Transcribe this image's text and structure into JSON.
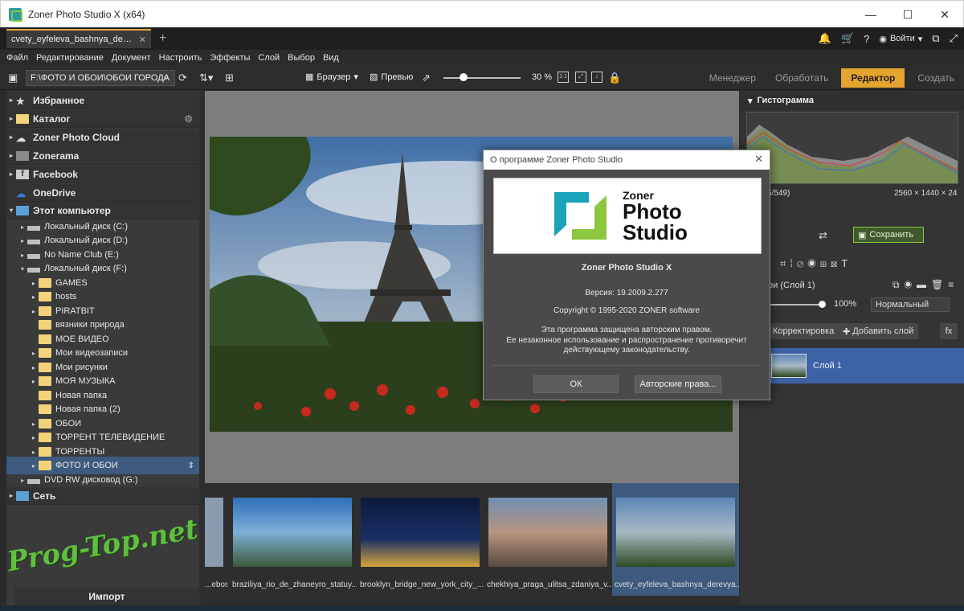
{
  "window": {
    "title": "Zoner Photo Studio X (x64)"
  },
  "tab": {
    "label": "cvety_eyfeleva_bashnya_dere..."
  },
  "header_right": {
    "login": "Войти"
  },
  "menu": [
    "Файл",
    "Редактирование",
    "Документ",
    "Настроить",
    "Эффекты",
    "Слой",
    "Выбор",
    "Вид"
  ],
  "toolbar": {
    "path": "F:\\ФОТО И ОБОИ\\ОБОИ ГОРОДА",
    "browser": "Браузер",
    "preview": "Превью",
    "zoom": "30 %",
    "fit_label": "1:1"
  },
  "modes": [
    "Менеджер",
    "Обработать",
    "Редактор",
    "Создать"
  ],
  "navigator": {
    "top_items": [
      {
        "label": "Избранное",
        "icon": "star-icon"
      },
      {
        "label": "Каталог",
        "icon": "catalog-icon"
      },
      {
        "label": "Zoner Photo Cloud",
        "icon": "cloud-icon"
      },
      {
        "label": "Zonerama",
        "icon": "zonerama-icon"
      },
      {
        "label": "Facebook",
        "icon": "facebook-icon"
      },
      {
        "label": "OneDrive",
        "icon": "onedrive-icon"
      },
      {
        "label": "Этот компьютер",
        "icon": "computer-icon"
      }
    ],
    "drives": [
      "Локальный диск (C:)",
      "Локальный диск (D:)",
      "No Name Club (E:)",
      "Локальный диск (F:)"
    ],
    "folders": [
      "GAMES",
      "hosts",
      "PIRATBIT",
      "вязники природа",
      "МОЕ ВИДЕО",
      "Мои видеозаписи",
      "Мои рисунки",
      "МОЯ МУЗЫКА",
      "Новая папка",
      "Новая папка (2)",
      "ОБОИ",
      "ТОРРЕНТ ТЕЛЕВИДЕНИЕ",
      "ТОРРЕНТЫ",
      "ФОТО И ОБОИ"
    ],
    "dvd": "DVD RW дисковод (G:)",
    "network": "Сеть",
    "import": "Импорт"
  },
  "filmstrip": [
    {
      "label": "...ebos..."
    },
    {
      "label": "braziliya_rio_de_zhaneyro_statuy..."
    },
    {
      "label": "brooklyn_bridge_new_york_city_..."
    },
    {
      "label": "chekhiya_praga_ulitsa_zdaniya_v..."
    },
    {
      "label": "cvety_eyfeleva_bashnya_derevya..."
    }
  ],
  "right_panel": {
    "histogram_title": "Гистограмма",
    "count": "5/549)",
    "dimensions": "2560 × 1440 × 24",
    "save": "Сохранить",
    "layers_title": "ои (Слой 1)",
    "opacity": "100%",
    "blend_mode": "Нормальный",
    "correction": "Корректировка",
    "add_layer": "Добавить слой",
    "fx": "fx",
    "layer_name": "Слой 1"
  },
  "dialog": {
    "title": "О программе Zoner Photo Studio",
    "logo_text": [
      "Zoner",
      "Photo",
      "Studio"
    ],
    "product": "Zoner Photo Studio X",
    "version": "Версия: 19.2009.2.277",
    "copyright": "Copyright © 1995-2020 ZONER software",
    "notice_1": "Эта программа защищена авторским правом.",
    "notice_2": "Ее незаконное использование и распространение противоречит",
    "notice_3": "действующему законодательству.",
    "ok": "ОК",
    "rights": "Авторские права..."
  },
  "watermark": "Prog-Top.net",
  "colors": {
    "accent": "#e5a430",
    "selection": "#3e5a7e",
    "layer_sel": "#3e62a6",
    "save_green": "#8dc63f",
    "logo_teal": "#1aa3b8",
    "logo_green": "#8dc63f"
  }
}
